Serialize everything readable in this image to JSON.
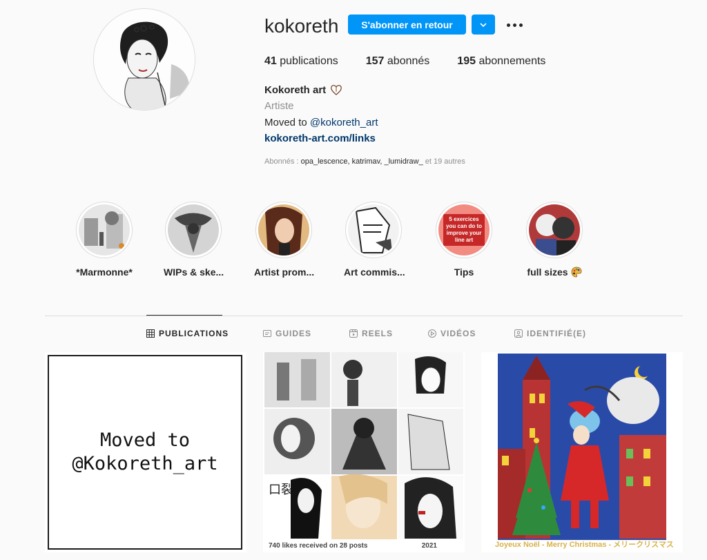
{
  "profile": {
    "username": "kokoreth",
    "follow_button": "S'abonner en retour",
    "stats": {
      "publications_count": "41",
      "publications_label": "publications",
      "followers_count": "157",
      "followers_label": "abonnés",
      "following_count": "195",
      "following_label": "abonnements"
    },
    "full_name": "Kokoreth art",
    "category": "Artiste",
    "bio_prefix": "Moved to ",
    "bio_mention": "@kokoreth_art",
    "link": "kokoreth-art.com/links",
    "followed_by_prefix": "Abonnés : ",
    "followed_by_names": "opa_lescence, katrimav, _lumidraw_",
    "followed_by_suffix": " et 19 autres"
  },
  "highlights": [
    {
      "label": "*Marmonne*"
    },
    {
      "label": "WIPs & ske..."
    },
    {
      "label": "Artist prom..."
    },
    {
      "label": "Art commis..."
    },
    {
      "label": "Tips",
      "cover_text": "5 exercices you can do to improve your line art"
    },
    {
      "label": "full sizes"
    }
  ],
  "tabs": [
    {
      "label": "PUBLICATIONS",
      "icon": "grid-icon"
    },
    {
      "label": "GUIDES",
      "icon": "guides-icon"
    },
    {
      "label": "REELS",
      "icon": "reels-icon"
    },
    {
      "label": "VIDÉOS",
      "icon": "play-icon"
    },
    {
      "label": "IDENTIFIÉ(E)",
      "icon": "tag-icon"
    }
  ],
  "posts": [
    {
      "text": "Moved to @Kokoreth_art"
    },
    {
      "text": "740 likes received on 28 posts",
      "year": "2021",
      "kanji": "口裂け女"
    },
    {
      "text": "Joyeux Noël - Merry Christmas - メリークリスマス"
    }
  ],
  "colors": {
    "accent": "#0095f6",
    "link": "#00376b",
    "muted": "#8e8e8e"
  }
}
